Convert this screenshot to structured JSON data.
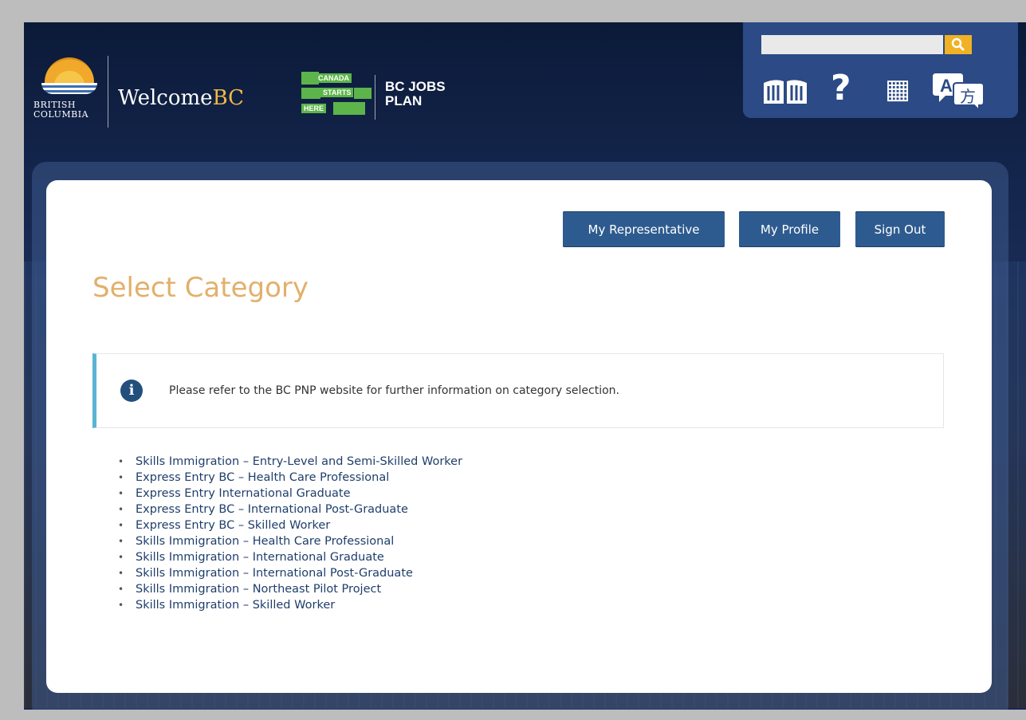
{
  "header": {
    "bc_logo_lines": [
      "BRITISH",
      "COLUMBIA"
    ],
    "welcome_prefix": "Welcome",
    "welcome_suffix": "BC",
    "canada_logo": {
      "canada": "CANADA",
      "starts": "STARTS",
      "here": "HERE"
    },
    "jobs_plan_lines": [
      "BC JOBS",
      "PLAN"
    ],
    "search": {
      "value": "",
      "placeholder": ""
    },
    "toolbox_icons": [
      "search-icon",
      "book-icon",
      "help-icon",
      "calculator-icon",
      "translate-icon"
    ]
  },
  "actions": {
    "my_representative": "My Representative",
    "my_profile": "My Profile",
    "sign_out": "Sign Out"
  },
  "page": {
    "title": "Select Category",
    "info_message": "Please refer to the BC PNP website for further information on category selection."
  },
  "categories": [
    "Skills Immigration – Entry-Level and Semi-Skilled Worker",
    "Express Entry BC – Health Care Professional",
    "Express Entry International Graduate",
    "Express Entry BC – International Post-Graduate",
    "Express Entry BC – Skilled Worker",
    "Skills Immigration – Health Care Professional",
    "Skills Immigration – International Graduate",
    "Skills Immigration – International Post-Graduate",
    "Skills Immigration – Northeast Pilot Project",
    "Skills Immigration – Skilled Worker"
  ],
  "colors": {
    "button_blue": "#2e5b8f",
    "title_gold": "#e2b06a",
    "info_accent": "#5bb3d6",
    "search_button": "#f0b124",
    "link_text": "#1f3e6b"
  }
}
